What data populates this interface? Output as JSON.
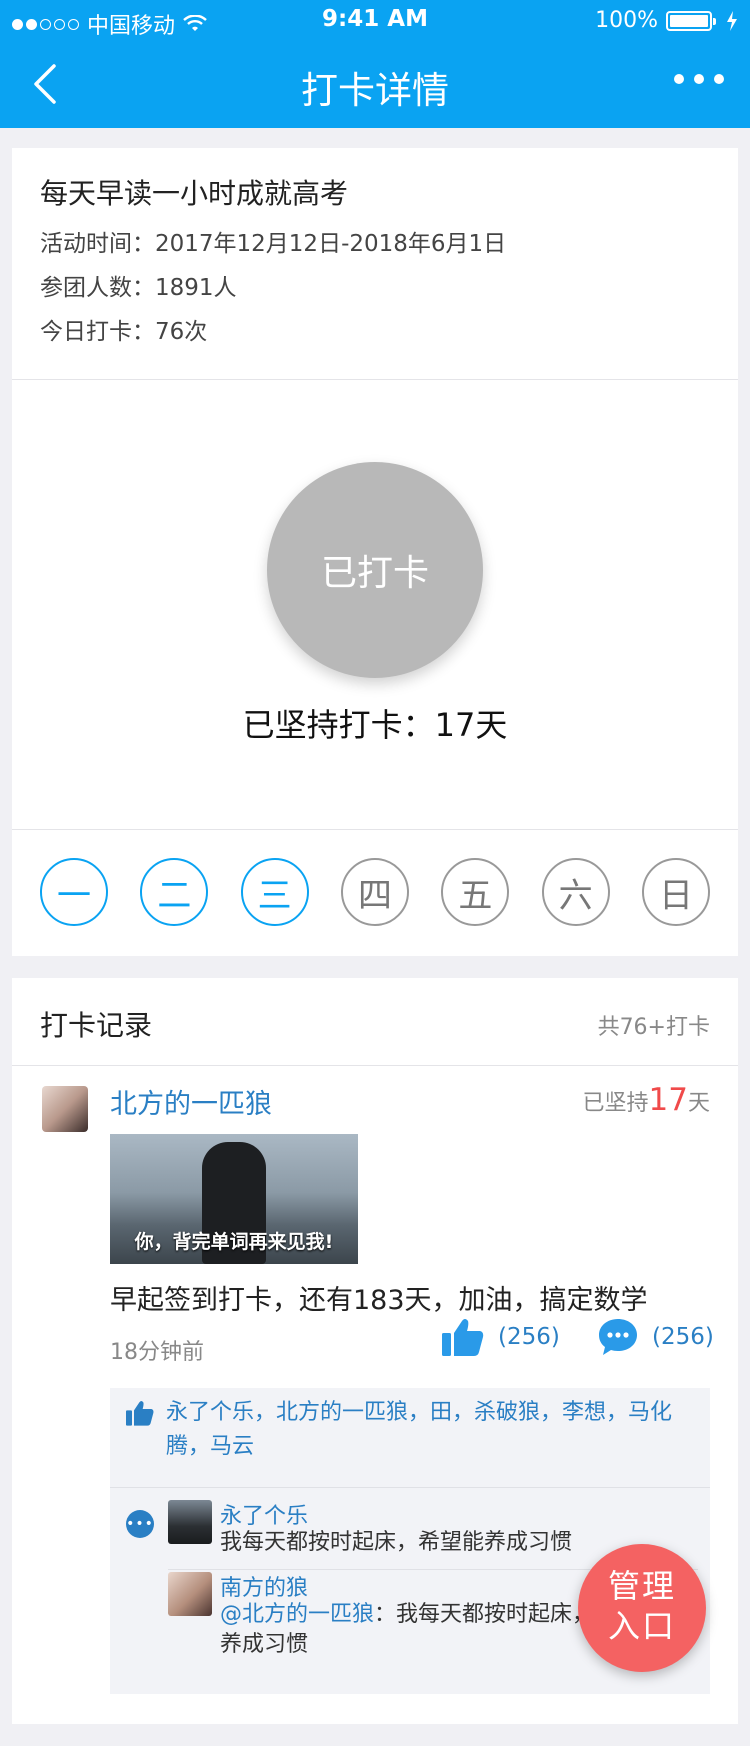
{
  "status_bar": {
    "carrier": "中国移动",
    "time": "9:41 AM",
    "battery": "100%"
  },
  "navbar": {
    "title": "打卡详情"
  },
  "activity": {
    "title": "每天早读一小时成就高考",
    "time_line": "活动时间：2017年12月12日-2018年6月1日",
    "members_line": "参团人数：1891人",
    "today_line": "今日打卡：76次"
  },
  "checkin": {
    "button_label": "已打卡",
    "streak_text": "已坚持打卡：17天"
  },
  "week": {
    "days": [
      {
        "label": "一",
        "done": true
      },
      {
        "label": "二",
        "done": true
      },
      {
        "label": "三",
        "done": true
      },
      {
        "label": "四",
        "done": false
      },
      {
        "label": "五",
        "done": false
      },
      {
        "label": "六",
        "done": false
      },
      {
        "label": "日",
        "done": false
      }
    ]
  },
  "records": {
    "title": "打卡记录",
    "total": "共76+打卡",
    "post": {
      "user": "北方的一匹狼",
      "persist_prefix": "已坚持",
      "persist_days": "17",
      "persist_suffix": "天",
      "image_caption": "你，背完单词再来见我!",
      "text": "早起签到打卡，还有183天，加油，搞定数学",
      "time_ago": "18分钟前",
      "like_count": "(256)",
      "comment_count": "(256)",
      "likers": "永了个乐，北方的一匹狼，田，杀破狼，李想，马化腾，马云",
      "comments": [
        {
          "user": "永了个乐",
          "text": "我每天都按时起床，希望能养成习惯"
        },
        {
          "user": "南方的狼",
          "mention": "@北方的一匹狼",
          "text": "：我每天都按时起床，希望能养成习惯"
        }
      ]
    }
  },
  "fab": {
    "line1": "管理",
    "line2": "入口"
  },
  "colors": {
    "primary": "#0aa3f2",
    "link": "#2a7fc4",
    "accent_red": "#f04a4a",
    "fab": "#f46262",
    "checked_gray": "#b8b8b8"
  }
}
